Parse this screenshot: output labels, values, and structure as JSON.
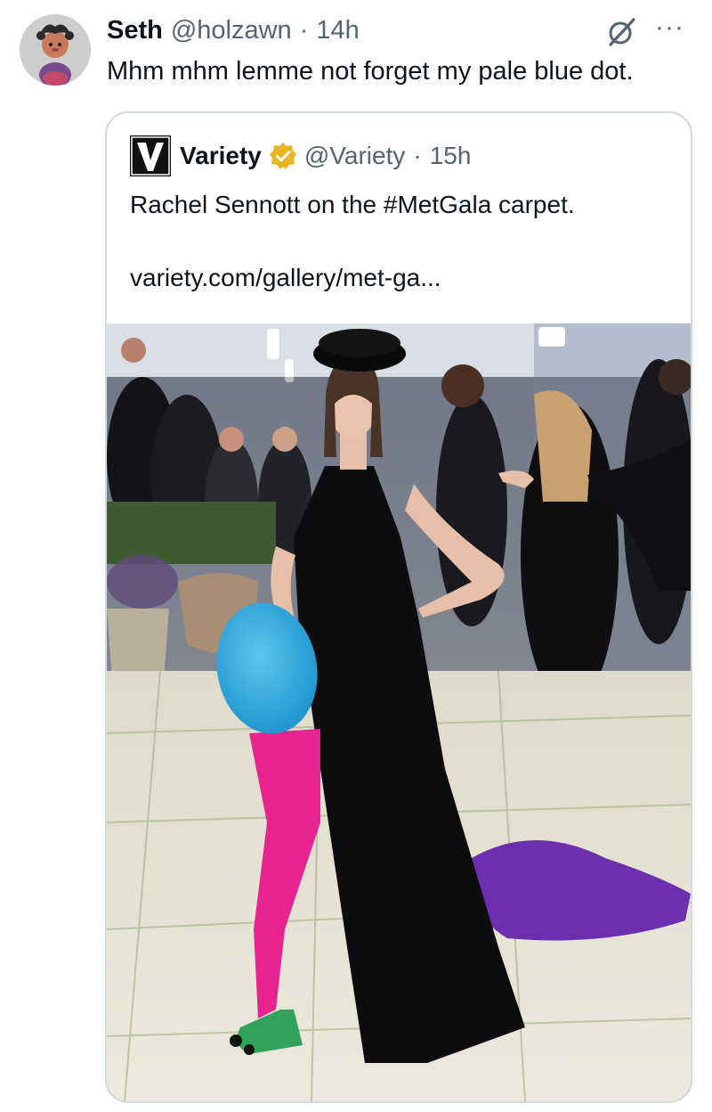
{
  "tweet": {
    "author_name": "Seth",
    "handle": "@holzawn",
    "separator": "·",
    "time": "14h",
    "text": "Mhm mhm lemme not forget my pale blue dot.",
    "more_label": "···"
  },
  "quoted": {
    "author_name": "Variety",
    "handle": "@Variety",
    "separator": "·",
    "time": "15h",
    "text": "Rachel Sennott on the #MetGala carpet.",
    "link": "variety.com/gallery/met-ga..."
  },
  "colors": {
    "text_primary": "#0f1419",
    "text_muted": "#536471",
    "border": "#cfd9de",
    "verified_gold": "#e8b423",
    "dot_blue": "#2ba7db",
    "tights_pink": "#e8238f",
    "train_purple": "#6d2eb0"
  }
}
